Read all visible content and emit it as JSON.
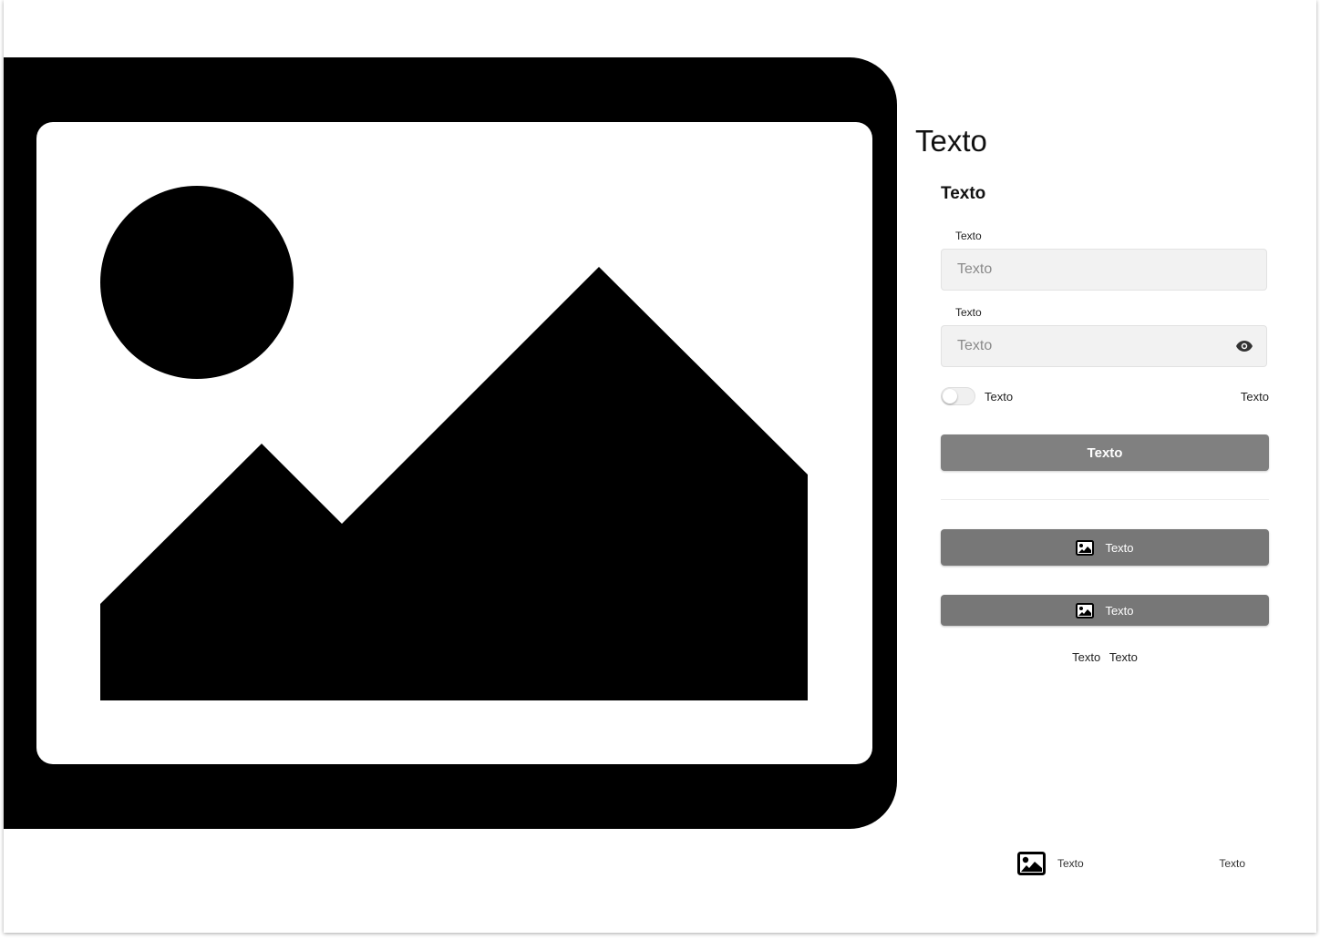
{
  "hero": {
    "image_icon": "image-placeholder-icon"
  },
  "form": {
    "title": "Texto",
    "subtitle": "Texto",
    "field1": {
      "label": "Texto",
      "placeholder": "Texto"
    },
    "field2": {
      "label": "Texto",
      "placeholder": "Texto",
      "icon": "eye-icon"
    },
    "toggle": {
      "label": "Texto",
      "on": false
    },
    "toggle_right_text": "Texto",
    "primary_button": "Texto",
    "icon_button_1": {
      "label": "Texto",
      "icon": "image-icon"
    },
    "icon_button_2": {
      "label": "Texto",
      "icon": "image-icon"
    },
    "links": [
      "Texto",
      "Texto"
    ]
  },
  "footer": {
    "icon": "image-icon",
    "left_text": "Texto",
    "right_text": "Texto"
  },
  "colors": {
    "primary_button": "#808080",
    "icon_button": "#777777",
    "input_background": "#f2f2f2"
  }
}
